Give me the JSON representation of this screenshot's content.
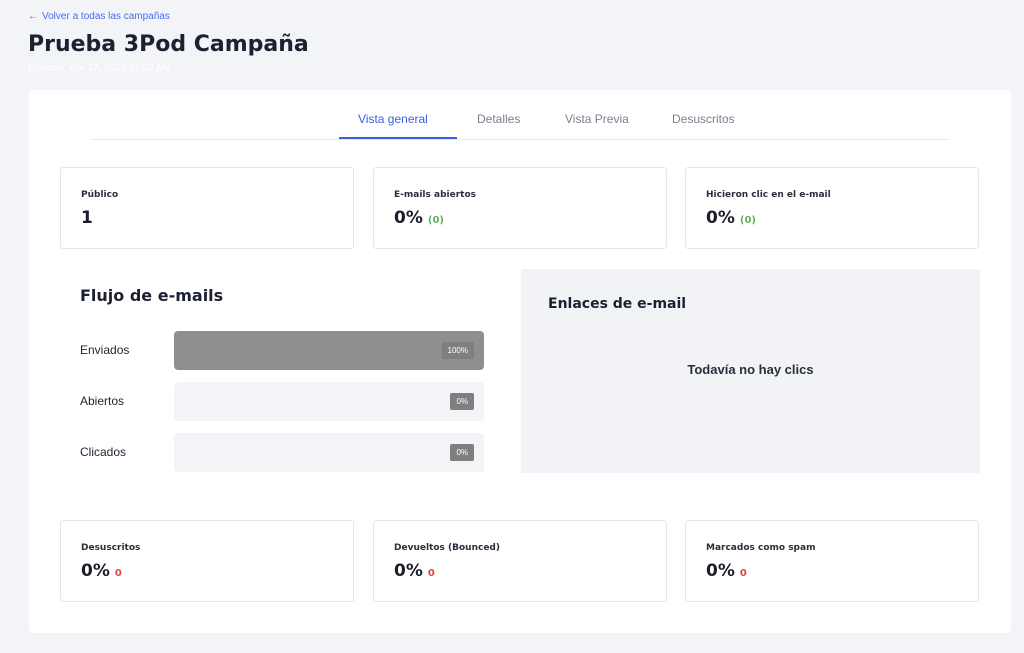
{
  "header": {
    "back_link": "Volver a todas las campañas",
    "title": "Prueba 3Pod Campaña",
    "subtitle": "Enviado: Abr 17, 2023 11:03 AM"
  },
  "tabs": [
    {
      "label": "Vista general",
      "active": true
    },
    {
      "label": "Detalles",
      "active": false
    },
    {
      "label": "Vista Previa",
      "active": false
    },
    {
      "label": "Desuscritos",
      "active": false
    }
  ],
  "top_stats": [
    {
      "label": "Público",
      "value": "1",
      "delta": ""
    },
    {
      "label": "E-mails abiertos",
      "value": "0%",
      "delta": "(0)"
    },
    {
      "label": "Hicieron clic en el e-mail",
      "value": "0%",
      "delta": "(0)"
    }
  ],
  "flow": {
    "title": "Flujo de e-mails",
    "rows": [
      {
        "label": "Enviados",
        "percent_label": "100%",
        "fraction": 1.0
      },
      {
        "label": "Abiertos",
        "percent_label": "0%",
        "fraction": 0.0
      },
      {
        "label": "Clicados",
        "percent_label": "0%",
        "fraction": 0.0
      }
    ]
  },
  "links": {
    "title": "Enlaces de e-mail",
    "empty_text": "Todavía no hay clics"
  },
  "bottom_stats": [
    {
      "label": "Desuscritos",
      "value": "0%",
      "delta": "0"
    },
    {
      "label": "Devueltos (Bounced)",
      "value": "0%",
      "delta": "0"
    },
    {
      "label": "Marcados como spam",
      "value": "0%",
      "delta": "0"
    }
  ],
  "colors": {
    "accent": "#3b5fe0",
    "positive": "#62b25c",
    "negative": "#e0463f",
    "bar_fill": "#8f8f8f"
  }
}
